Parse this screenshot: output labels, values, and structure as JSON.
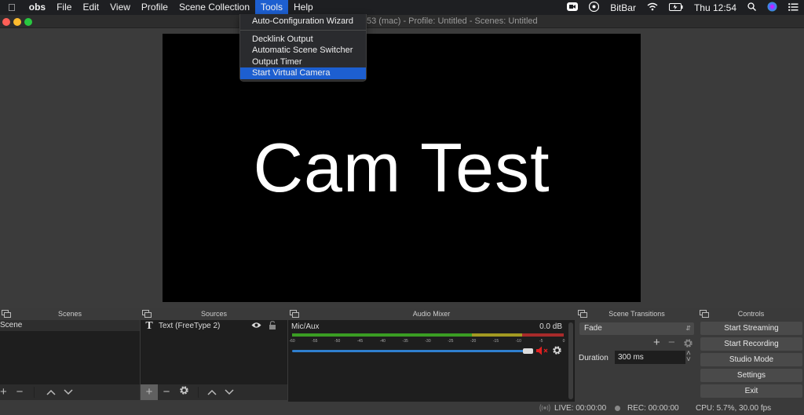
{
  "menubar": {
    "apple": "",
    "app_name": "obs",
    "items": [
      "File",
      "Edit",
      "View",
      "Profile",
      "Scene Collection",
      "Tools",
      "Help"
    ],
    "active_item": "Tools",
    "status_right": {
      "bitbar": "BitBar",
      "clock": "Thu 12:54"
    }
  },
  "window": {
    "title": "53 (mac) - Profile: Untitled - Scenes: Untitled",
    "traffic_lights": {
      "close": "#fe5f57",
      "minimize": "#febc2e",
      "zoom": "#28c840"
    }
  },
  "tools_menu": {
    "items": [
      {
        "label": "Auto-Configuration Wizard"
      },
      {
        "label": "Decklink Output"
      },
      {
        "label": "Automatic Scene Switcher"
      },
      {
        "label": "Output Timer"
      },
      {
        "label": "Start Virtual Camera",
        "highlighted": true
      }
    ]
  },
  "preview": {
    "text": "Cam Test"
  },
  "scenes": {
    "title": "Scenes",
    "items": [
      "Scene"
    ]
  },
  "sources": {
    "title": "Sources",
    "items": [
      {
        "label": "Text (FreeType 2)",
        "visible": true,
        "locked": false
      }
    ]
  },
  "audio_mixer": {
    "title": "Audio Mixer",
    "channel": {
      "name": "Mic/Aux",
      "level": "0.0 dB",
      "ticks": [
        "-60",
        "-55",
        "-50",
        "-45",
        "-40",
        "-35",
        "-30",
        "-25",
        "-20",
        "-15",
        "-10",
        "-5",
        "0"
      ],
      "volume_fraction": 1.0,
      "muted": true
    }
  },
  "transitions": {
    "title": "Scene Transitions",
    "selected": "Fade",
    "duration_label": "Duration",
    "duration_value": "300 ms"
  },
  "controls": {
    "title": "Controls",
    "buttons": [
      "Start Streaming",
      "Start Recording",
      "Studio Mode",
      "Settings",
      "Exit"
    ]
  },
  "statusbar": {
    "live": "LIVE: 00:00:00",
    "rec": "REC: 00:00:00",
    "cpu": "CPU: 5.7%, 30.00 fps"
  }
}
